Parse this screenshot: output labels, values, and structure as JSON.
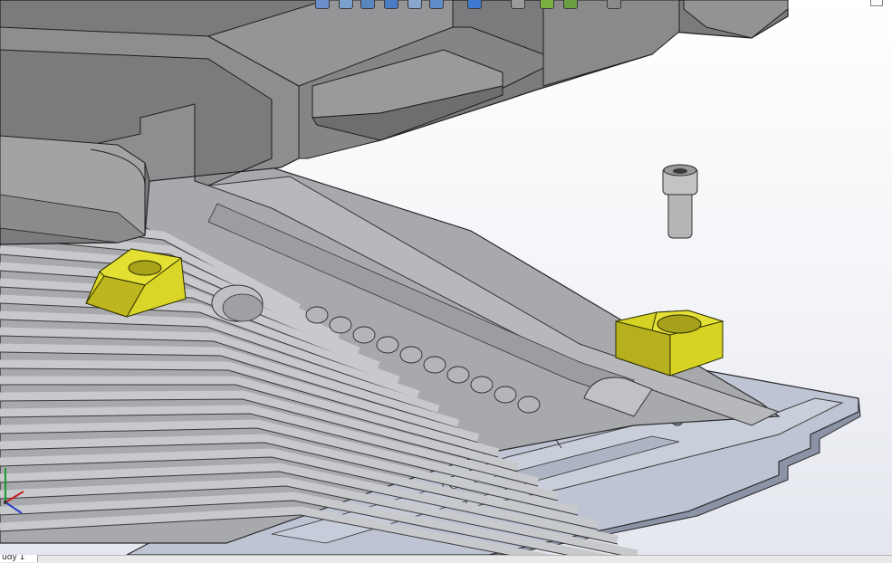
{
  "tabs": [
    {
      "label": "udy 1",
      "active": true
    }
  ],
  "heads_up_toolbar": {
    "icons": [
      "zoom-to-fit-icon",
      "zoom-area-icon",
      "previous-view-icon",
      "section-view-icon",
      "dynamic-annotation-icon",
      "view-orientation-icon",
      "display-style-icon",
      "hide-show-items-icon",
      "edit-appearance-icon",
      "apply-scene-icon",
      "view-settings-icon"
    ]
  },
  "colors": {
    "background_top": "#ffffff",
    "background_bottom": "#e4e7ee",
    "part_dark_gray": "#7b7b7b",
    "part_light_gray": "#a9aaae",
    "base_plate": "#bcc2d3",
    "clamp_yellow": "#d6d325",
    "bolt_gray": "#b0b0b0"
  }
}
